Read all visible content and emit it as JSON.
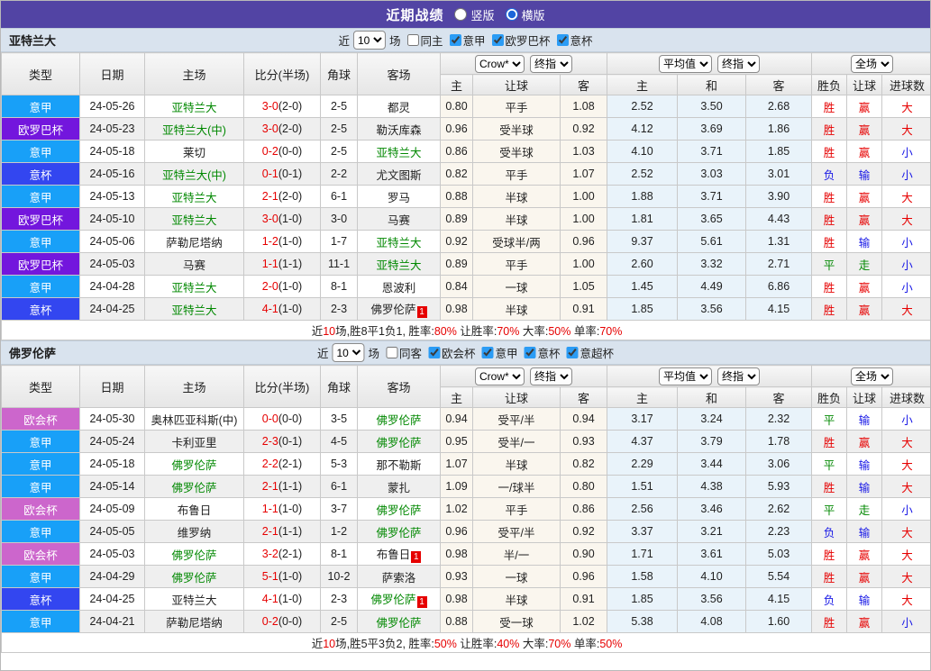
{
  "header": {
    "title": "近期战绩",
    "view_options": [
      {
        "label": "竖版",
        "selected": false
      },
      {
        "label": "横版",
        "selected": true
      }
    ]
  },
  "colors": {
    "league": {
      "意甲": "#18a0f8",
      "欧罗巴杯": "#7316dd",
      "意杯": "#3346f0",
      "欧会杯": "#cc66cc"
    },
    "accent_checkbox": "#2b9cf5",
    "win_red": "#e60000",
    "lose_blue": "#1a1ae6",
    "draw_green": "#008800"
  },
  "table": {
    "columns_left": [
      "类型",
      "日期",
      "主场",
      "比分(半场)",
      "角球",
      "客场"
    ],
    "sub_columns": [
      "主",
      "让球",
      "客",
      "主",
      "和",
      "客",
      "胜负",
      "让球",
      "进球数"
    ],
    "dropdowns": {
      "odds": [
        "Crow*",
        "终指"
      ],
      "avg": [
        "平均值",
        "终指"
      ],
      "result": [
        "全场"
      ]
    }
  },
  "sections": [
    {
      "team": "亚特兰大",
      "filter": {
        "prefix": "近",
        "count": "10",
        "suffix": "场",
        "checks": [
          {
            "label": "同主",
            "checked": false
          },
          {
            "label": "意甲",
            "checked": true
          },
          {
            "label": "欧罗巴杯",
            "checked": true
          },
          {
            "label": "意杯",
            "checked": true
          }
        ]
      },
      "rows": [
        {
          "league": "意甲",
          "date": "24-05-26",
          "home": {
            "name": "亚特兰大",
            "green": true
          },
          "score": "3-0",
          "half": "(2-0)",
          "corner": "2-5",
          "away": {
            "name": "都灵",
            "green": false
          },
          "odds": [
            "0.80",
            "平手",
            "1.08"
          ],
          "avg": [
            "2.52",
            "3.50",
            "2.68"
          ],
          "res": [
            [
              "胜",
              "r"
            ],
            [
              "赢",
              "r"
            ],
            [
              "大",
              "r"
            ]
          ]
        },
        {
          "league": "欧罗巴杯",
          "date": "24-05-23",
          "home": {
            "name": "亚特兰大(中)",
            "green": true
          },
          "score": "3-0",
          "half": "(2-0)",
          "corner": "2-5",
          "away": {
            "name": "勒沃库森",
            "green": false
          },
          "odds": [
            "0.96",
            "受半球",
            "0.92"
          ],
          "avg": [
            "4.12",
            "3.69",
            "1.86"
          ],
          "res": [
            [
              "胜",
              "r"
            ],
            [
              "赢",
              "r"
            ],
            [
              "大",
              "r"
            ]
          ]
        },
        {
          "league": "意甲",
          "date": "24-05-18",
          "home": {
            "name": "莱切",
            "green": false
          },
          "score": "0-2",
          "half": "(0-0)",
          "corner": "2-5",
          "away": {
            "name": "亚特兰大",
            "green": true
          },
          "odds": [
            "0.86",
            "受半球",
            "1.03"
          ],
          "avg": [
            "4.10",
            "3.71",
            "1.85"
          ],
          "res": [
            [
              "胜",
              "r"
            ],
            [
              "赢",
              "r"
            ],
            [
              "小",
              "b"
            ]
          ]
        },
        {
          "league": "意杯",
          "date": "24-05-16",
          "home": {
            "name": "亚特兰大(中)",
            "green": true
          },
          "score": "0-1",
          "half": "(0-1)",
          "corner": "2-2",
          "away": {
            "name": "尤文图斯",
            "green": false
          },
          "odds": [
            "0.82",
            "平手",
            "1.07"
          ],
          "avg": [
            "2.52",
            "3.03",
            "3.01"
          ],
          "res": [
            [
              "负",
              "b"
            ],
            [
              "输",
              "b"
            ],
            [
              "小",
              "b"
            ]
          ]
        },
        {
          "league": "意甲",
          "date": "24-05-13",
          "home": {
            "name": "亚特兰大",
            "green": true
          },
          "score": "2-1",
          "half": "(2-0)",
          "corner": "6-1",
          "away": {
            "name": "罗马",
            "green": false
          },
          "odds": [
            "0.88",
            "半球",
            "1.00"
          ],
          "avg": [
            "1.88",
            "3.71",
            "3.90"
          ],
          "res": [
            [
              "胜",
              "r"
            ],
            [
              "赢",
              "r"
            ],
            [
              "大",
              "r"
            ]
          ]
        },
        {
          "league": "欧罗巴杯",
          "date": "24-05-10",
          "home": {
            "name": "亚特兰大",
            "green": true
          },
          "score": "3-0",
          "half": "(1-0)",
          "corner": "3-0",
          "away": {
            "name": "马赛",
            "green": false
          },
          "odds": [
            "0.89",
            "半球",
            "1.00"
          ],
          "avg": [
            "1.81",
            "3.65",
            "4.43"
          ],
          "res": [
            [
              "胜",
              "r"
            ],
            [
              "赢",
              "r"
            ],
            [
              "大",
              "r"
            ]
          ]
        },
        {
          "league": "意甲",
          "date": "24-05-06",
          "home": {
            "name": "萨勒尼塔纳",
            "green": false
          },
          "score": "1-2",
          "half": "(1-0)",
          "corner": "1-7",
          "away": {
            "name": "亚特兰大",
            "green": true
          },
          "odds": [
            "0.92",
            "受球半/两",
            "0.96"
          ],
          "avg": [
            "9.37",
            "5.61",
            "1.31"
          ],
          "res": [
            [
              "胜",
              "r"
            ],
            [
              "输",
              "b"
            ],
            [
              "小",
              "b"
            ]
          ]
        },
        {
          "league": "欧罗巴杯",
          "date": "24-05-03",
          "home": {
            "name": "马赛",
            "green": false
          },
          "score": "1-1",
          "half": "(1-1)",
          "corner": "11-1",
          "away": {
            "name": "亚特兰大",
            "green": true
          },
          "odds": [
            "0.89",
            "平手",
            "1.00"
          ],
          "avg": [
            "2.60",
            "3.32",
            "2.71"
          ],
          "res": [
            [
              "平",
              "g"
            ],
            [
              "走",
              "g"
            ],
            [
              "小",
              "b"
            ]
          ]
        },
        {
          "league": "意甲",
          "date": "24-04-28",
          "home": {
            "name": "亚特兰大",
            "green": true
          },
          "score": "2-0",
          "half": "(1-0)",
          "corner": "8-1",
          "away": {
            "name": "恩波利",
            "green": false
          },
          "odds": [
            "0.84",
            "一球",
            "1.05"
          ],
          "avg": [
            "1.45",
            "4.49",
            "6.86"
          ],
          "res": [
            [
              "胜",
              "r"
            ],
            [
              "赢",
              "r"
            ],
            [
              "小",
              "b"
            ]
          ]
        },
        {
          "league": "意杯",
          "date": "24-04-25",
          "home": {
            "name": "亚特兰大",
            "green": true
          },
          "score": "4-1",
          "half": "(1-0)",
          "corner": "2-3",
          "away": {
            "name": "佛罗伦萨",
            "green": false,
            "badge": "1"
          },
          "odds": [
            "0.98",
            "半球",
            "0.91"
          ],
          "avg": [
            "1.85",
            "3.56",
            "4.15"
          ],
          "res": [
            [
              "胜",
              "r"
            ],
            [
              "赢",
              "r"
            ],
            [
              "大",
              "r"
            ]
          ]
        }
      ],
      "summary": [
        [
          "近",
          "k"
        ],
        [
          "10",
          "r"
        ],
        [
          "场,胜8平1负1, 胜率:",
          "k"
        ],
        [
          "80%",
          "r"
        ],
        [
          " 让胜率:",
          "k"
        ],
        [
          "70%",
          "r"
        ],
        [
          " 大率:",
          "k"
        ],
        [
          "50%",
          "r"
        ],
        [
          " 单率:",
          "k"
        ],
        [
          "70%",
          "r"
        ]
      ]
    },
    {
      "team": "佛罗伦萨",
      "filter": {
        "prefix": "近",
        "count": "10",
        "suffix": "场",
        "checks": [
          {
            "label": "同客",
            "checked": false
          },
          {
            "label": "欧会杯",
            "checked": true
          },
          {
            "label": "意甲",
            "checked": true
          },
          {
            "label": "意杯",
            "checked": true
          },
          {
            "label": "意超杯",
            "checked": true
          }
        ]
      },
      "rows": [
        {
          "league": "欧会杯",
          "date": "24-05-30",
          "home": {
            "name": "奥林匹亚科斯(中)",
            "green": false
          },
          "score": "0-0",
          "half": "(0-0)",
          "corner": "3-5",
          "away": {
            "name": "佛罗伦萨",
            "green": true
          },
          "odds": [
            "0.94",
            "受平/半",
            "0.94"
          ],
          "avg": [
            "3.17",
            "3.24",
            "2.32"
          ],
          "res": [
            [
              "平",
              "g"
            ],
            [
              "输",
              "b"
            ],
            [
              "小",
              "b"
            ]
          ]
        },
        {
          "league": "意甲",
          "date": "24-05-24",
          "home": {
            "name": "卡利亚里",
            "green": false
          },
          "score": "2-3",
          "half": "(0-1)",
          "corner": "4-5",
          "away": {
            "name": "佛罗伦萨",
            "green": true
          },
          "odds": [
            "0.95",
            "受半/一",
            "0.93"
          ],
          "avg": [
            "4.37",
            "3.79",
            "1.78"
          ],
          "res": [
            [
              "胜",
              "r"
            ],
            [
              "赢",
              "r"
            ],
            [
              "大",
              "r"
            ]
          ]
        },
        {
          "league": "意甲",
          "date": "24-05-18",
          "home": {
            "name": "佛罗伦萨",
            "green": true
          },
          "score": "2-2",
          "half": "(2-1)",
          "corner": "5-3",
          "away": {
            "name": "那不勒斯",
            "green": false
          },
          "odds": [
            "1.07",
            "半球",
            "0.82"
          ],
          "avg": [
            "2.29",
            "3.44",
            "3.06"
          ],
          "res": [
            [
              "平",
              "g"
            ],
            [
              "输",
              "b"
            ],
            [
              "大",
              "r"
            ]
          ]
        },
        {
          "league": "意甲",
          "date": "24-05-14",
          "home": {
            "name": "佛罗伦萨",
            "green": true
          },
          "score": "2-1",
          "half": "(1-1)",
          "corner": "6-1",
          "away": {
            "name": "蒙扎",
            "green": false
          },
          "odds": [
            "1.09",
            "一/球半",
            "0.80"
          ],
          "avg": [
            "1.51",
            "4.38",
            "5.93"
          ],
          "res": [
            [
              "胜",
              "r"
            ],
            [
              "输",
              "b"
            ],
            [
              "大",
              "r"
            ]
          ]
        },
        {
          "league": "欧会杯",
          "date": "24-05-09",
          "home": {
            "name": "布鲁日",
            "green": false
          },
          "score": "1-1",
          "half": "(1-0)",
          "corner": "3-7",
          "away": {
            "name": "佛罗伦萨",
            "green": true
          },
          "odds": [
            "1.02",
            "平手",
            "0.86"
          ],
          "avg": [
            "2.56",
            "3.46",
            "2.62"
          ],
          "res": [
            [
              "平",
              "g"
            ],
            [
              "走",
              "g"
            ],
            [
              "小",
              "b"
            ]
          ]
        },
        {
          "league": "意甲",
          "date": "24-05-05",
          "home": {
            "name": "维罗纳",
            "green": false
          },
          "score": "2-1",
          "half": "(1-1)",
          "corner": "1-2",
          "away": {
            "name": "佛罗伦萨",
            "green": true
          },
          "odds": [
            "0.96",
            "受平/半",
            "0.92"
          ],
          "avg": [
            "3.37",
            "3.21",
            "2.23"
          ],
          "res": [
            [
              "负",
              "b"
            ],
            [
              "输",
              "b"
            ],
            [
              "大",
              "r"
            ]
          ]
        },
        {
          "league": "欧会杯",
          "date": "24-05-03",
          "home": {
            "name": "佛罗伦萨",
            "green": true
          },
          "score": "3-2",
          "half": "(2-1)",
          "corner": "8-1",
          "away": {
            "name": "布鲁日",
            "green": false,
            "badge": "1"
          },
          "odds": [
            "0.98",
            "半/一",
            "0.90"
          ],
          "avg": [
            "1.71",
            "3.61",
            "5.03"
          ],
          "res": [
            [
              "胜",
              "r"
            ],
            [
              "赢",
              "r"
            ],
            [
              "大",
              "r"
            ]
          ]
        },
        {
          "league": "意甲",
          "date": "24-04-29",
          "home": {
            "name": "佛罗伦萨",
            "green": true
          },
          "score": "5-1",
          "half": "(1-0)",
          "corner": "10-2",
          "away": {
            "name": "萨索洛",
            "green": false
          },
          "odds": [
            "0.93",
            "一球",
            "0.96"
          ],
          "avg": [
            "1.58",
            "4.10",
            "5.54"
          ],
          "res": [
            [
              "胜",
              "r"
            ],
            [
              "赢",
              "r"
            ],
            [
              "大",
              "r"
            ]
          ]
        },
        {
          "league": "意杯",
          "date": "24-04-25",
          "home": {
            "name": "亚特兰大",
            "green": false
          },
          "score": "4-1",
          "half": "(1-0)",
          "corner": "2-3",
          "away": {
            "name": "佛罗伦萨",
            "green": true,
            "badge": "1"
          },
          "odds": [
            "0.98",
            "半球",
            "0.91"
          ],
          "avg": [
            "1.85",
            "3.56",
            "4.15"
          ],
          "res": [
            [
              "负",
              "b"
            ],
            [
              "输",
              "b"
            ],
            [
              "大",
              "r"
            ]
          ]
        },
        {
          "league": "意甲",
          "date": "24-04-21",
          "home": {
            "name": "萨勒尼塔纳",
            "green": false
          },
          "score": "0-2",
          "half": "(0-0)",
          "corner": "2-5",
          "away": {
            "name": "佛罗伦萨",
            "green": true
          },
          "odds": [
            "0.88",
            "受一球",
            "1.02"
          ],
          "avg": [
            "5.38",
            "4.08",
            "1.60"
          ],
          "res": [
            [
              "胜",
              "r"
            ],
            [
              "赢",
              "r"
            ],
            [
              "小",
              "b"
            ]
          ]
        }
      ],
      "summary": [
        [
          "近",
          "k"
        ],
        [
          "10",
          "r"
        ],
        [
          "场,胜5平3负2, 胜率:",
          "k"
        ],
        [
          "50%",
          "r"
        ],
        [
          " 让胜率:",
          "k"
        ],
        [
          "40%",
          "r"
        ],
        [
          " 大率:",
          "k"
        ],
        [
          "70%",
          "r"
        ],
        [
          " 单率:",
          "k"
        ],
        [
          "50%",
          "r"
        ]
      ]
    }
  ]
}
